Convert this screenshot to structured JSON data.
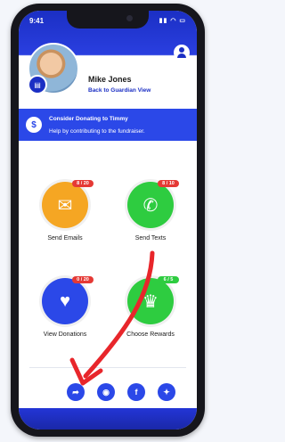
{
  "status": {
    "time": "9:41",
    "signal_icons": "▮▮ ◠ ▭"
  },
  "profile": {
    "name": "Mike Jones",
    "back_link": "Back to Guardian View"
  },
  "banner": {
    "title": "Consider Donating to Timmy",
    "subtitle": "Help by contributing to the fundraiser."
  },
  "actions": [
    {
      "label": "Send Emails",
      "badge": "8 / 20",
      "icon": "envelope-icon",
      "color": "#f5a623",
      "badge_color": "#e53935"
    },
    {
      "label": "Send Texts",
      "badge": "8 / 10",
      "icon": "phone-message-icon",
      "color": "#2ecc40",
      "badge_color": "#e53935"
    },
    {
      "label": "View Donations",
      "badge": "0 / 20",
      "icon": "piggy-bank-icon",
      "color": "#2b48e8",
      "badge_color": "#e53935"
    },
    {
      "label": "Choose Rewards",
      "badge": "6 / 5",
      "icon": "trophy-icon",
      "color": "#2ecc40",
      "badge_color": "#2ecc40"
    }
  ],
  "social": [
    {
      "icon": "share-icon",
      "glyph": "➦"
    },
    {
      "icon": "messenger-icon",
      "glyph": "◉"
    },
    {
      "icon": "facebook-icon",
      "glyph": "f"
    },
    {
      "icon": "twitter-icon",
      "glyph": "✦"
    }
  ],
  "colors": {
    "primary": "#1b2fc4",
    "banner": "#2b48e8",
    "annotation_arrow": "#e8262b"
  }
}
